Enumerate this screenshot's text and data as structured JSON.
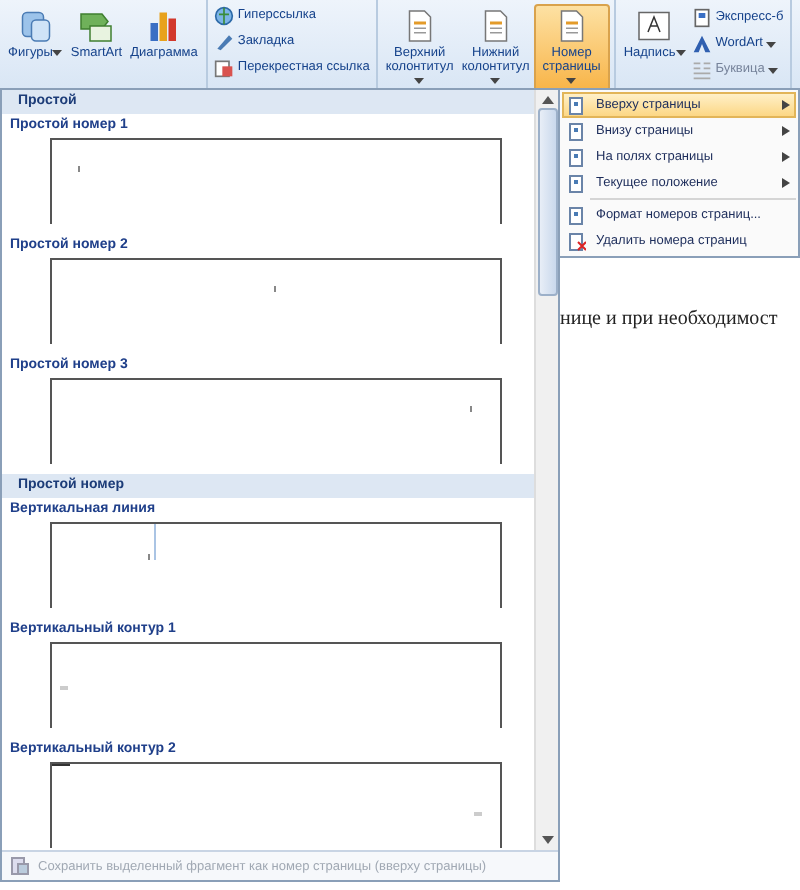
{
  "ribbon": {
    "groups": [
      {
        "buttons": [
          {
            "label": "Фигуры",
            "dropdown": true,
            "selected": false,
            "disabled": false
          },
          {
            "label": "SmartArt",
            "dropdown": false,
            "selected": false,
            "disabled": false
          },
          {
            "label": "Диаграмма",
            "dropdown": false,
            "selected": false,
            "disabled": false
          }
        ]
      },
      {
        "buttons": [
          {
            "label": "Гиперссылка",
            "dropdown": false,
            "selected": false,
            "disabled": false
          },
          {
            "label": "Закладка",
            "dropdown": false,
            "selected": false,
            "disabled": false
          },
          {
            "label": "Перекрестная ссылка",
            "dropdown": false,
            "selected": false,
            "disabled": false
          }
        ]
      },
      {
        "buttons": [
          {
            "label": "Верхний колонтитул",
            "dropdown": true,
            "selected": false,
            "disabled": false
          },
          {
            "label": "Нижний колонтитул",
            "dropdown": true,
            "selected": false,
            "disabled": false
          },
          {
            "label": "Номер страницы",
            "dropdown": true,
            "selected": true,
            "disabled": false
          }
        ]
      },
      {
        "buttons": [
          {
            "label": "Надпись",
            "dropdown": true,
            "selected": false,
            "disabled": false
          },
          {
            "label": "Экспресс-б",
            "dropdown": false,
            "selected": false,
            "disabled": false
          },
          {
            "label": "WordArt",
            "dropdown": true,
            "selected": false,
            "disabled": false
          },
          {
            "label": "Буквица",
            "dropdown": true,
            "selected": false,
            "disabled": true
          }
        ]
      }
    ]
  },
  "document": {
    "text": "нице и при необходимост"
  },
  "gallery": {
    "sections": [
      {
        "title": "Простой",
        "items": [
          {
            "label": "Простой номер 1",
            "kind": "left"
          },
          {
            "label": "Простой номер 2",
            "kind": "center"
          },
          {
            "label": "Простой номер 3",
            "kind": "right"
          }
        ]
      },
      {
        "title": "Простой номер",
        "items": [
          {
            "label": "Вертикальная линия",
            "kind": "line"
          },
          {
            "label": "Вертикальный контур 1",
            "kind": "contour-left"
          },
          {
            "label": "Вертикальный контур 2",
            "kind": "contour-right"
          }
        ]
      }
    ],
    "footer": {
      "label": "Сохранить выделенный фрагмент как номер страницы (вверху страницы)",
      "disabled": true
    }
  },
  "menu": {
    "items": [
      {
        "label": "Вверху страницы",
        "submenu": true,
        "selected": true
      },
      {
        "label": "Внизу страницы",
        "submenu": true,
        "selected": false
      },
      {
        "label": "На полях страницы",
        "submenu": true,
        "selected": false
      },
      {
        "label": "Текущее положение",
        "submenu": true,
        "selected": false
      },
      {
        "label": "Формат номеров страниц...",
        "submenu": false,
        "selected": false
      },
      {
        "label": "Удалить номера страниц",
        "submenu": false,
        "selected": false
      }
    ]
  }
}
